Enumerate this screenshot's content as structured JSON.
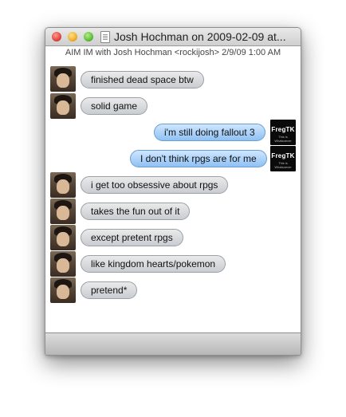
{
  "window": {
    "title": "Josh Hochman on 2009-02-09 at...",
    "info": "AIM IM with Josh Hochman <rockijosh>  2/9/09 1:00 AM"
  },
  "avatars": {
    "incoming": "portrait",
    "outgoing": {
      "brand": "FregTK",
      "tagline": "This is Whatsoever"
    }
  },
  "messages": [
    {
      "text": "finished dead space btw",
      "from": "them"
    },
    {
      "text": "solid game",
      "from": "them"
    },
    {
      "text": "i'm still doing fallout 3",
      "from": "me"
    },
    {
      "text": "I don't think rpgs are for me",
      "from": "me"
    },
    {
      "text": "i get too obsessive about rpgs",
      "from": "them"
    },
    {
      "text": "takes the fun out of it",
      "from": "them"
    },
    {
      "text": "except pretent rpgs",
      "from": "them"
    },
    {
      "text": "like kingdom hearts/pokemon",
      "from": "them"
    },
    {
      "text": "pretend*",
      "from": "them"
    }
  ]
}
